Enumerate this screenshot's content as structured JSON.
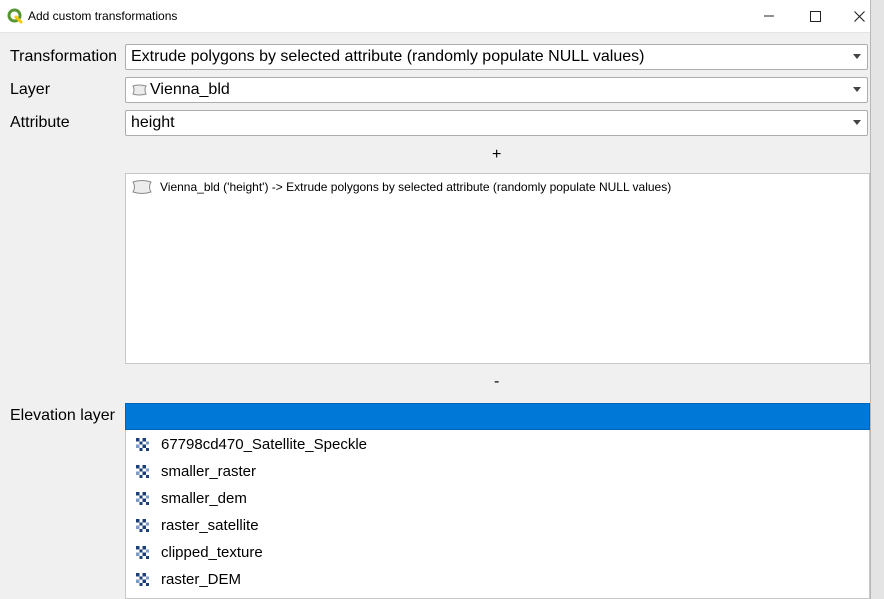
{
  "window": {
    "title": "Add custom transformations",
    "minimize_icon": "minimize-icon",
    "maximize_icon": "maximize-icon",
    "close_icon": "close-icon"
  },
  "form": {
    "transformation_label": "Transformation",
    "transformation_value": "Extrude polygons by selected attribute (randomly populate NULL values)",
    "layer_label": "Layer",
    "layer_value": "Vienna_bld",
    "attribute_label": "Attribute",
    "attribute_value": "height",
    "add_button": "+",
    "remove_button": "-",
    "elevation_label": "Elevation layer"
  },
  "transform_list": [
    "Vienna_bld ('height')  ->  Extrude polygons by selected attribute (randomly populate NULL values)"
  ],
  "elevation_options": [
    "67798cd470_Satellite_Speckle",
    "smaller_raster",
    "smaller_dem",
    "raster_satellite",
    "clipped_texture",
    "raster_DEM"
  ],
  "colors": {
    "selection": "#0078d7",
    "app_icon_green": "#589632",
    "app_icon_yellow": "#ee7913"
  }
}
